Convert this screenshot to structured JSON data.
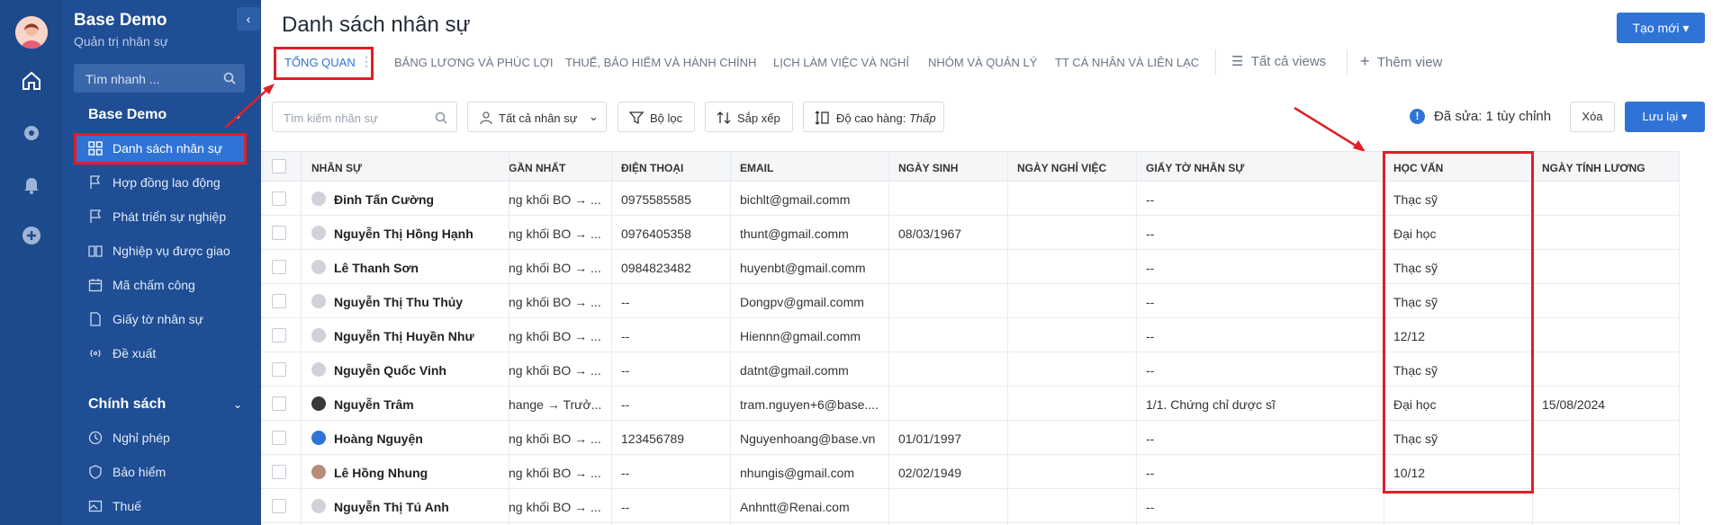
{
  "app": {
    "name": "Base Demo",
    "subtitle": "Quản trị nhân sự"
  },
  "rail_icons": [
    "home-icon",
    "settings-icon",
    "bell-icon",
    "plus-circle-icon"
  ],
  "sidebar": {
    "search_placeholder": "Tìm nhanh ...",
    "section1": "Base Demo",
    "items": [
      {
        "label": "Danh sách nhân sự",
        "icon": "grid-icon",
        "active": true
      },
      {
        "label": "Hợp đồng lao động",
        "icon": "flag-icon"
      },
      {
        "label": "Phát triển sự nghiệp",
        "icon": "flag-icon"
      },
      {
        "label": "Nghiệp vụ được giao",
        "icon": "book-icon"
      },
      {
        "label": "Mã chấm công",
        "icon": "calendar-icon"
      },
      {
        "label": "Giấy tờ nhân sự",
        "icon": "document-icon"
      },
      {
        "label": "Đề xuất",
        "icon": "broadcast-icon"
      }
    ],
    "section2": "Chính sách",
    "items2": [
      {
        "label": "Nghỉ phép",
        "icon": "clock-icon"
      },
      {
        "label": "Bảo hiểm",
        "icon": "shield-icon"
      },
      {
        "label": "Thuế",
        "icon": "image-icon"
      }
    ]
  },
  "header": {
    "title": "Danh sách nhân sự",
    "create_button": "Tạo mới",
    "tabs": [
      "TỔNG QUAN",
      "BẢNG LƯƠNG VÀ PHÚC LỢI",
      "THUẾ, BẢO HIỂM VÀ HÀNH CHÍNH",
      "LỊCH LÀM VIỆC VÀ NGHỈ",
      "NHÓM VÀ QUẢN LÝ",
      "TT CÁ NHÂN VÀ LIÊN LẠC"
    ],
    "all_views": "Tất cả views",
    "add_view": "Thêm view"
  },
  "toolbar": {
    "search_placeholder": "Tìm kiếm nhân sự",
    "all_staff": "Tất cả nhân sự",
    "filter": "Bộ lọc",
    "sort": "Sắp xếp",
    "row_height_label": "Độ cao hàng:",
    "row_height_value": "Thấp",
    "edited": "Đã sửa: 1 tùy chỉnh",
    "delete": "Xóa",
    "save": "Lưu lại"
  },
  "table": {
    "columns": [
      "NHÂN SỰ",
      "GẦN NHẤT",
      "ĐIỆN THOẠI",
      "EMAIL",
      "NGÀY SINH",
      "NGÀY NGHỈ VIỆC",
      "GIẤY TỜ NHÂN SỰ",
      "HỌC VẤN",
      "NGÀY TÍNH LƯƠNG"
    ],
    "column_headers_shown": [
      "NHÂN SỰ",
      "GẦN NHẤT",
      "ĐIỆN THOẠI",
      "EMAIL",
      "NGÀY SINH",
      "NGÀY NGHỈ VIỆC",
      "GIẤY TỜ NHÂN SỰ",
      "HỌC VẤN",
      "NGÀY TÍNH LƯƠNG"
    ],
    "rows": [
      {
        "name": "Đinh Tấn Cường",
        "recent": "ng khối BO → ...",
        "phone": "0975585585",
        "email": "bichlt@gmail.comm",
        "dob": "",
        "leave": "",
        "docs": "--",
        "edu": "Thạc sỹ",
        "pay": ""
      },
      {
        "name": "Nguyễn Thị Hồng Hạnh",
        "recent": "ng khối BO → ...",
        "phone": "0976405358",
        "email": "thunt@gmail.comm",
        "dob": "08/03/1967",
        "leave": "",
        "docs": "--",
        "edu": "Đại học",
        "pay": ""
      },
      {
        "name": "Lê Thanh Sơn",
        "recent": "ng khối BO → ...",
        "phone": "0984823482",
        "email": "huyenbt@gmail.comm",
        "dob": "",
        "leave": "",
        "docs": "--",
        "edu": "Thạc sỹ",
        "pay": ""
      },
      {
        "name": "Nguyễn Thị Thu Thủy",
        "recent": "ng khối BO → ...",
        "phone": "--",
        "email": "Dongpv@gmail.comm",
        "dob": "",
        "leave": "",
        "docs": "--",
        "edu": "Thạc sỹ",
        "pay": ""
      },
      {
        "name": "Nguyễn Thị Huyền Như",
        "recent": "ng khối BO → ...",
        "phone": "--",
        "email": "Hiennn@gmail.comm",
        "dob": "",
        "leave": "",
        "docs": "--",
        "edu": "12/12",
        "pay": ""
      },
      {
        "name": "Nguyễn Quốc Vinh",
        "recent": "ng khối BO → ...",
        "phone": "--",
        "email": "datnt@gmail.comm",
        "dob": "",
        "leave": "",
        "docs": "--",
        "edu": "Thạc sỹ",
        "pay": ""
      },
      {
        "name": "Nguyễn Trâm",
        "recent": "hange → Trưở...",
        "phone": "--",
        "email": "tram.nguyen+6@base....",
        "dob": "",
        "leave": "",
        "docs": "1/1. Chứng chỉ dược sĩ",
        "edu": "Đại học",
        "pay": "15/08/2024"
      },
      {
        "name": "Hoàng Nguyện",
        "recent": "ng khối BO → ...",
        "phone": "123456789",
        "email": "Nguyenhoang@base.vn",
        "dob": "01/01/1997",
        "leave": "",
        "docs": "--",
        "edu": "Thạc sỹ",
        "pay": ""
      },
      {
        "name": "Lê Hồng Nhung",
        "recent": "ng khối BO → ...",
        "phone": "--",
        "email": "nhungis@gmail.com",
        "dob": "02/02/1949",
        "leave": "",
        "docs": "--",
        "edu": "10/12",
        "pay": ""
      },
      {
        "name": "Nguyễn Thị Tú Anh",
        "recent": "ng khối BO → ...",
        "phone": "--",
        "email": "Anhntt@Renai.com",
        "dob": "",
        "leave": "",
        "docs": "--",
        "edu": "",
        "pay": ""
      }
    ]
  },
  "colors": {
    "rail": "#1d4a8c",
    "sidebar": "#1f4e95",
    "accent": "#2f73d6",
    "highlight": "#e11e26"
  }
}
